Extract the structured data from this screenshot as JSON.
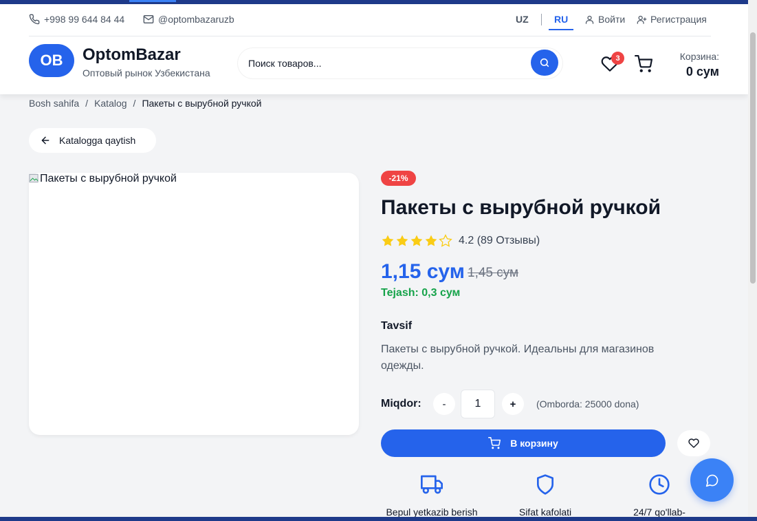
{
  "topbar": {
    "phone": "+998 99 644 84 44",
    "telegram": "@optombazaruzb",
    "languages": [
      "UZ",
      "RU"
    ],
    "active_language": "RU",
    "login": "Войти",
    "register": "Регистрация"
  },
  "brand": {
    "badge": "OB",
    "name": "OptomBazar",
    "tagline": "Оптовый рынок Узбекистана"
  },
  "search": {
    "placeholder": "Поиск товаров..."
  },
  "header": {
    "wishlist_count": "3",
    "cart_label": "Корзина:",
    "cart_total": "0 сум"
  },
  "breadcrumb": {
    "home": "Bosh sahifa",
    "catalog": "Katalog",
    "current": "Пакеты с вырубной ручкой"
  },
  "back_button": "Katalogga qaytish",
  "product": {
    "image_alt": "Пакеты с вырубной ручкой",
    "discount": "-21%",
    "title": "Пакеты с вырубной ручкой",
    "rating": 4.2,
    "rating_text": "4.2 (89 Отзывы)",
    "price": "1,15 сум",
    "old_price": "1,45 сум",
    "savings": "Tejash: 0,3 сум",
    "description_heading": "Tavsif",
    "description": "Пакеты с вырубной ручкой. Идеальны для магазинов одежды.",
    "quantity_label": "Miqdor:",
    "quantity": "1",
    "decrement": "-",
    "increment": "+",
    "stock": "(Omborda: 25000 dona)",
    "add_to_cart": "В корзину"
  },
  "features": [
    {
      "label": "Bepul yetkazib berish",
      "icon": "truck-icon"
    },
    {
      "label": "Sifat kafolati",
      "icon": "shield-icon"
    },
    {
      "label": "24/7 qo'llab-",
      "icon": "clock-icon"
    }
  ],
  "colors": {
    "accent": "#2563eb",
    "danger": "#ef4444",
    "success": "#16a34a",
    "star": "#facc15"
  }
}
